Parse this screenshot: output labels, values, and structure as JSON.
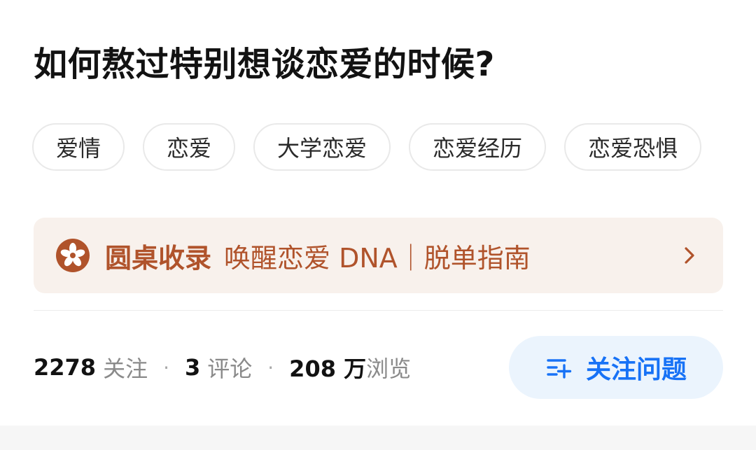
{
  "question": {
    "title": "如何熬过特别想谈恋爱的时候?"
  },
  "tags": [
    {
      "label": "爱情"
    },
    {
      "label": "恋爱"
    },
    {
      "label": "大学恋爱"
    },
    {
      "label": "恋爱经历"
    },
    {
      "label": "恋爱恐惧"
    }
  ],
  "roundtable": {
    "label": "圆桌收录",
    "text": "唤醒恋爱 DNA｜脱单指南",
    "icon": "roundtable-flower-icon",
    "color": "#b0532b",
    "background": "#f8f1ec"
  },
  "stats": {
    "followers_count": "2278",
    "followers_label": "关注",
    "comments_count": "3",
    "comments_label": "评论",
    "views_count": "208 万",
    "views_label": "浏览",
    "separator": "·"
  },
  "follow_button": {
    "label": "关注问题",
    "icon": "add-list-icon",
    "color": "#1772f6",
    "background": "#ebf4fd"
  }
}
